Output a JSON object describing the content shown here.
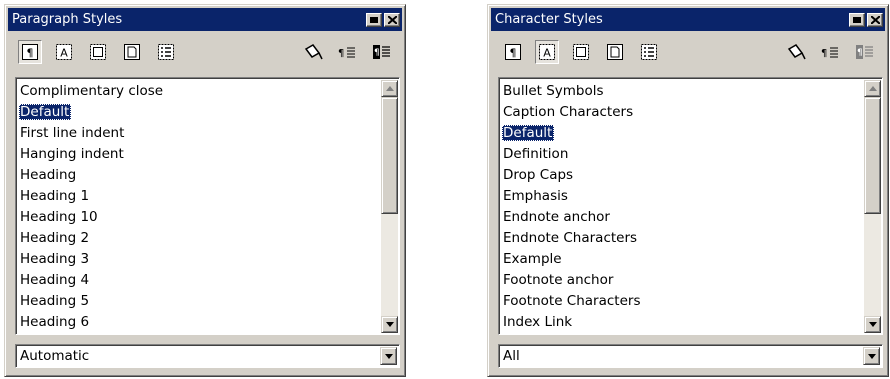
{
  "paragraph_styles": {
    "title": "Paragraph Styles",
    "items": [
      "Complimentary close",
      "Default",
      "First line indent",
      "Hanging indent",
      "Heading",
      "Heading 1",
      "Heading 10",
      "Heading 2",
      "Heading 3",
      "Heading 4",
      "Heading 5",
      "Heading 6"
    ],
    "selected": "Default",
    "filter_value": "Automatic"
  },
  "character_styles": {
    "title": "Character Styles",
    "items": [
      "Bullet Symbols",
      "Caption Characters",
      "Default",
      "Definition",
      "Drop Caps",
      "Emphasis",
      "Endnote anchor",
      "Endnote Characters",
      "Example",
      "Footnote anchor",
      "Footnote Characters",
      "Index Link"
    ],
    "selected": "Default",
    "filter_value": "All"
  },
  "toolbar_icons": [
    "paragraph-styles-icon",
    "character-styles-icon",
    "frame-styles-icon",
    "page-styles-icon",
    "numbering-styles-icon",
    "fill-format-mode-icon",
    "new-style-from-selection-icon",
    "update-style-icon"
  ],
  "colors": {
    "titlebar": "#0a246a",
    "selection": "#0a246a",
    "face": "#d4d0c8"
  }
}
